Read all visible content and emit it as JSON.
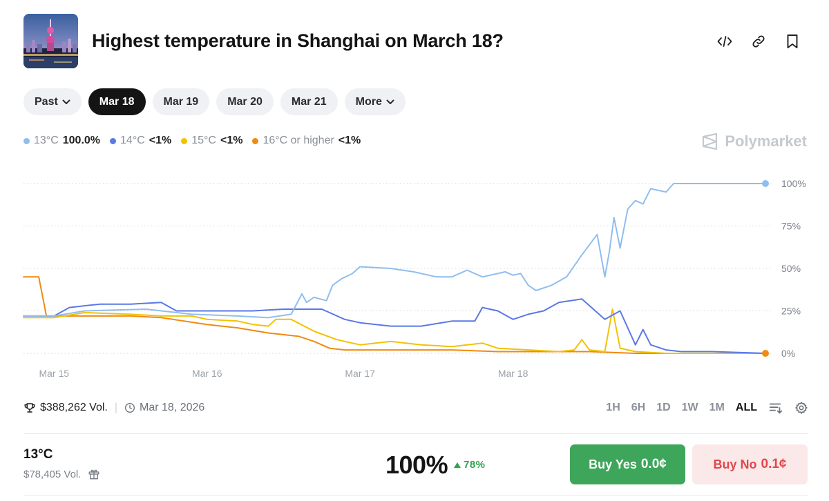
{
  "header": {
    "title": "Highest temperature in Shanghai on March 18?",
    "icons": [
      "thumbnail-image",
      "embed-code-icon",
      "link-icon",
      "bookmark-icon"
    ]
  },
  "tabs": [
    {
      "label": "Past",
      "dropdown": true,
      "active": false
    },
    {
      "label": "Mar 18",
      "active": true
    },
    {
      "label": "Mar 19",
      "active": false
    },
    {
      "label": "Mar 20",
      "active": false
    },
    {
      "label": "Mar 21",
      "active": false
    },
    {
      "label": "More",
      "dropdown": true,
      "active": false
    }
  ],
  "legend": [
    {
      "name": "13°C",
      "value": "100.0%",
      "color": "#90bdef"
    },
    {
      "name": "14°C",
      "value": "<1%",
      "color": "#5a78e6"
    },
    {
      "name": "15°C",
      "value": "<1%",
      "color": "#f2c200"
    },
    {
      "name": "16°C or higher",
      "value": "<1%",
      "color": "#f08a12"
    }
  ],
  "brand": "Polymarket",
  "chart_data": {
    "type": "line",
    "x_tick_labels": [
      "Mar 15",
      "Mar 16",
      "Mar 17",
      "Mar 18"
    ],
    "y_tick_labels": [
      "100%",
      "75%",
      "50%",
      "25%",
      "0%"
    ],
    "ylim": [
      0,
      100
    ],
    "xlim": [
      14.8,
      18.85
    ],
    "grid": "horizontal dotted",
    "series": [
      {
        "name": "13°C",
        "color": "#90bdef",
        "points": [
          [
            14.8,
            22
          ],
          [
            15.0,
            22
          ],
          [
            15.2,
            25
          ],
          [
            15.6,
            26
          ],
          [
            15.9,
            23
          ],
          [
            16.2,
            22
          ],
          [
            16.4,
            21
          ],
          [
            16.55,
            23
          ],
          [
            16.62,
            35
          ],
          [
            16.65,
            30
          ],
          [
            16.7,
            33
          ],
          [
            16.78,
            31
          ],
          [
            16.82,
            40
          ],
          [
            16.88,
            44
          ],
          [
            16.95,
            47
          ],
          [
            17.0,
            51
          ],
          [
            17.2,
            50
          ],
          [
            17.35,
            48
          ],
          [
            17.5,
            45
          ],
          [
            17.6,
            45
          ],
          [
            17.7,
            49
          ],
          [
            17.8,
            45
          ],
          [
            17.95,
            48
          ],
          [
            18.0,
            46
          ],
          [
            18.05,
            47
          ],
          [
            18.1,
            40
          ],
          [
            18.15,
            37
          ],
          [
            18.25,
            40
          ],
          [
            18.35,
            45
          ],
          [
            18.45,
            58
          ],
          [
            18.55,
            70
          ],
          [
            18.58,
            55
          ],
          [
            18.6,
            45
          ],
          [
            18.63,
            60
          ],
          [
            18.66,
            80
          ],
          [
            18.7,
            62
          ],
          [
            18.75,
            85
          ],
          [
            18.8,
            90
          ],
          [
            18.85,
            88
          ],
          [
            18.9,
            97
          ],
          [
            19.0,
            95
          ],
          [
            19.05,
            100
          ],
          [
            19.3,
            100
          ],
          [
            19.5,
            100
          ],
          [
            19.65,
            100
          ]
        ]
      },
      {
        "name": "14°C",
        "color": "#5a78e6",
        "points": [
          [
            14.8,
            22
          ],
          [
            15.0,
            22
          ],
          [
            15.1,
            27
          ],
          [
            15.3,
            29
          ],
          [
            15.5,
            29
          ],
          [
            15.7,
            30
          ],
          [
            15.8,
            25
          ],
          [
            16.1,
            25
          ],
          [
            16.3,
            25
          ],
          [
            16.5,
            26
          ],
          [
            16.75,
            26
          ],
          [
            16.9,
            20
          ],
          [
            17.0,
            18
          ],
          [
            17.2,
            16
          ],
          [
            17.4,
            16
          ],
          [
            17.6,
            19
          ],
          [
            17.75,
            19
          ],
          [
            17.8,
            27
          ],
          [
            17.9,
            25
          ],
          [
            18.0,
            20
          ],
          [
            18.1,
            23
          ],
          [
            18.2,
            25
          ],
          [
            18.3,
            30
          ],
          [
            18.45,
            32
          ],
          [
            18.6,
            20
          ],
          [
            18.7,
            25
          ],
          [
            18.8,
            5
          ],
          [
            18.85,
            14
          ],
          [
            18.9,
            5
          ],
          [
            19.0,
            2
          ],
          [
            19.1,
            1
          ],
          [
            19.3,
            1
          ],
          [
            19.65,
            0
          ]
        ]
      },
      {
        "name": "15°C",
        "color": "#f2c200",
        "points": [
          [
            14.8,
            21
          ],
          [
            15.0,
            21
          ],
          [
            15.2,
            24
          ],
          [
            15.5,
            23
          ],
          [
            15.7,
            22
          ],
          [
            15.9,
            22
          ],
          [
            16.0,
            20
          ],
          [
            16.2,
            19
          ],
          [
            16.3,
            17
          ],
          [
            16.4,
            16
          ],
          [
            16.45,
            20
          ],
          [
            16.55,
            20
          ],
          [
            16.7,
            13
          ],
          [
            16.85,
            8
          ],
          [
            17.0,
            5
          ],
          [
            17.2,
            7
          ],
          [
            17.4,
            5
          ],
          [
            17.6,
            4
          ],
          [
            17.8,
            6
          ],
          [
            17.9,
            3
          ],
          [
            18.1,
            2
          ],
          [
            18.3,
            1
          ],
          [
            18.4,
            2
          ],
          [
            18.45,
            8
          ],
          [
            18.5,
            2
          ],
          [
            18.6,
            1
          ],
          [
            18.65,
            26
          ],
          [
            18.7,
            3
          ],
          [
            18.8,
            1
          ],
          [
            19.0,
            0
          ],
          [
            19.65,
            0
          ]
        ]
      },
      {
        "name": "16°C or higher",
        "color": "#f08a12",
        "points": [
          [
            14.8,
            45
          ],
          [
            14.9,
            45
          ],
          [
            14.95,
            22
          ],
          [
            15.1,
            22
          ],
          [
            15.3,
            22
          ],
          [
            15.5,
            22
          ],
          [
            15.7,
            21
          ],
          [
            16.0,
            17
          ],
          [
            16.2,
            15
          ],
          [
            16.4,
            12
          ],
          [
            16.6,
            10
          ],
          [
            16.7,
            7
          ],
          [
            16.8,
            3
          ],
          [
            16.9,
            2
          ],
          [
            17.0,
            2
          ],
          [
            17.3,
            2
          ],
          [
            17.6,
            2
          ],
          [
            17.9,
            1
          ],
          [
            18.2,
            1
          ],
          [
            18.5,
            1
          ],
          [
            18.8,
            0
          ],
          [
            19.0,
            0
          ],
          [
            19.65,
            0
          ]
        ]
      }
    ]
  },
  "stats": {
    "volume": "$388,262 Vol.",
    "date": "Mar 18, 2026"
  },
  "ranges": [
    "1H",
    "6H",
    "1D",
    "1W",
    "1M",
    "ALL"
  ],
  "active_range": "ALL",
  "outcome": {
    "name": "13°C",
    "volume": "$78,405 Vol.",
    "probability": "100%",
    "change": "78%",
    "buy_yes_label": "Buy Yes",
    "buy_yes_price": "0.0¢",
    "buy_no_label": "Buy No",
    "buy_no_price": "0.1¢"
  }
}
